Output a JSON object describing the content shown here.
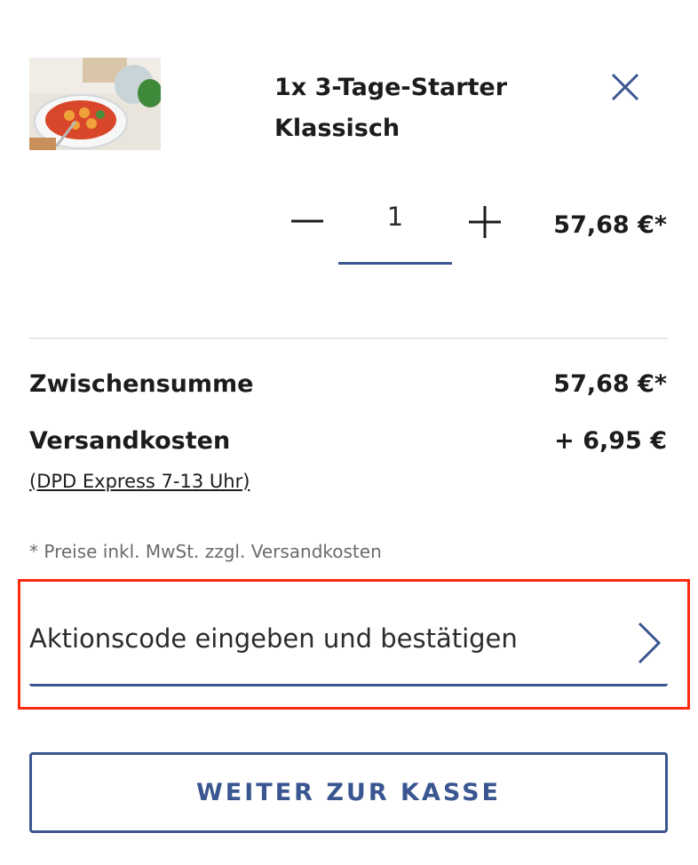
{
  "cart_item": {
    "title_line1": "1x 3-Tage-Starter",
    "title_line2": "Klassisch",
    "quantity": "1",
    "price": "57,68 €*",
    "image_icon": "pasta-dish-thumbnail"
  },
  "summary": {
    "subtotal_label": "Zwischensumme",
    "subtotal_value": "57,68 €*",
    "shipping_label": "Versandkosten",
    "shipping_value": "+ 6,95 €",
    "shipping_method": "(DPD Express 7-13 Uhr)",
    "note": "* Preise inkl. MwSt. zzgl. Versandkosten"
  },
  "promo": {
    "placeholder": "Aktionscode eingeben und bestätigen"
  },
  "checkout": {
    "label": "WEITER ZUR KASSE"
  },
  "colors": {
    "accent": "#3a5690",
    "highlight": "#ff2a0f",
    "text": "#1c1c1c",
    "muted": "#6b6b6b"
  }
}
